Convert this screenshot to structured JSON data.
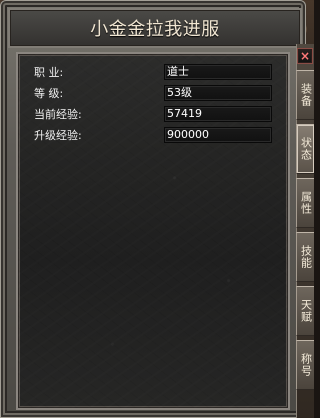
{
  "window": {
    "title": "小金金拉我进服"
  },
  "character_info": {
    "rows": [
      {
        "label": "职    业:",
        "value": "道士"
      },
      {
        "label": "等    级:",
        "value": "53级"
      },
      {
        "label": "当前经验:",
        "value": "57419"
      },
      {
        "label": "升级经验:",
        "value": "900000"
      }
    ]
  },
  "sidebar": {
    "close_label": "×",
    "tabs": [
      {
        "label": "装备"
      },
      {
        "label": "状态"
      },
      {
        "label": "属性"
      },
      {
        "label": "技能"
      },
      {
        "label": "天赋"
      },
      {
        "label": "称号"
      }
    ]
  },
  "colors": {
    "title_text": "#f1e6d2",
    "label_text": "#f1f1f1",
    "value_text": "#ffffff"
  }
}
